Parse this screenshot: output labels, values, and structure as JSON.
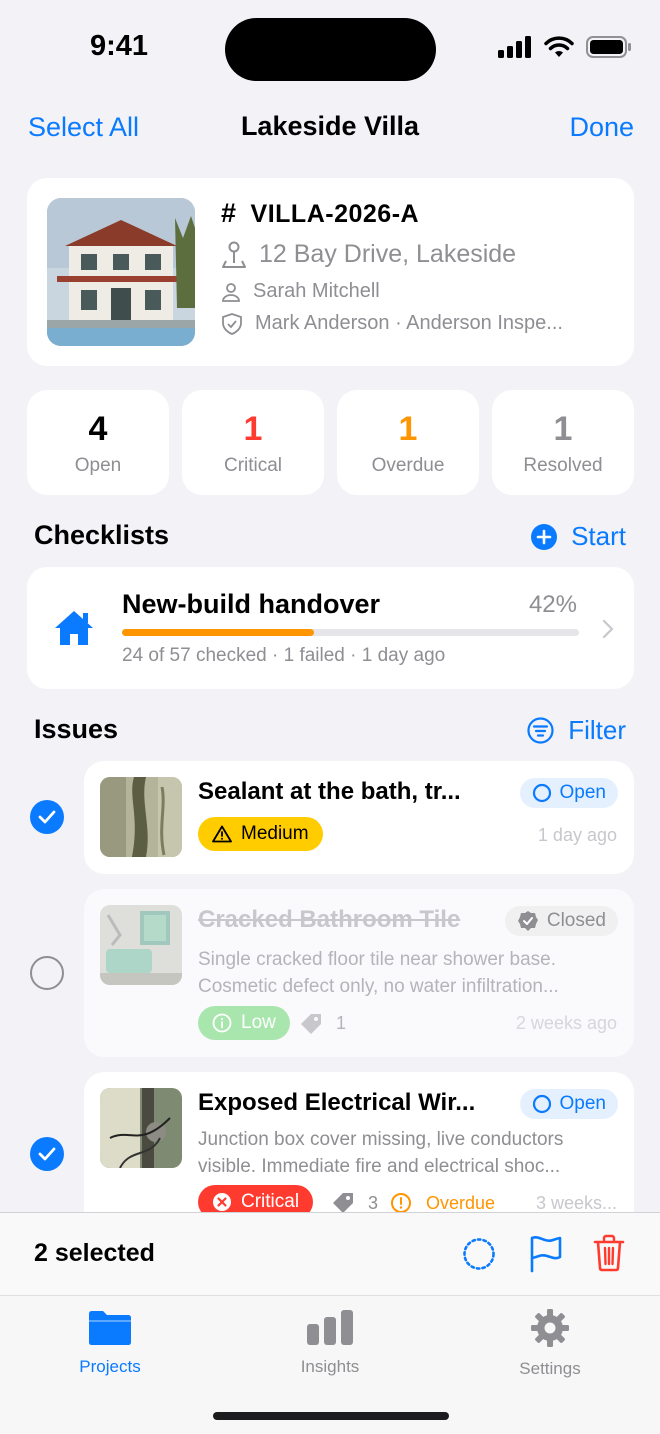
{
  "status_bar": {
    "time": "9:41"
  },
  "nav": {
    "left": "Select All",
    "title": "Lakeside Villa",
    "right": "Done"
  },
  "project": {
    "id": "VILLA-2026-A",
    "id_prefix": "#",
    "address": "12 Bay Drive, Lakeside",
    "owner": "Sarah Mitchell",
    "inspector": "Mark Anderson · Anderson Inspe..."
  },
  "stats": [
    {
      "value": "4",
      "label": "Open",
      "color": "#000000"
    },
    {
      "value": "1",
      "label": "Critical",
      "color": "#ff3b30"
    },
    {
      "value": "1",
      "label": "Overdue",
      "color": "#ff9500"
    },
    {
      "value": "1",
      "label": "Resolved",
      "color": "#8e8e93"
    }
  ],
  "checklists": {
    "title": "Checklists",
    "action": "Start",
    "items": [
      {
        "title": "New-build handover",
        "percent": "42%",
        "progress": 0.42,
        "subtitle": "24 of 57 checked · 1 failed · 1 day ago"
      }
    ]
  },
  "issues": {
    "title": "Issues",
    "action": "Filter",
    "items": [
      {
        "title": "Sealant at the bath, tr...",
        "status": "Open",
        "severity": "Medium",
        "time": "1 day ago",
        "selected": true
      },
      {
        "title": "Cracked Bathroom Tile",
        "status": "Closed",
        "description": "Single cracked floor tile near shower base. Cosmetic defect only, no water infiltration...",
        "severity": "Low",
        "tag_count": "1",
        "time": "2 weeks ago",
        "selected": false
      },
      {
        "title": "Exposed Electrical Wir...",
        "status": "Open",
        "description": "Junction box cover missing, live conductors visible. Immediate fire and electrical shoc...",
        "severity": "Critical",
        "tag_count": "3",
        "flag": "Overdue",
        "time": "3 weeks...",
        "selected": true
      }
    ]
  },
  "selection_bar": {
    "count": "2 selected"
  },
  "tabs": [
    {
      "label": "Projects",
      "icon": "folder-icon",
      "active": true
    },
    {
      "label": "Insights",
      "icon": "chart-bar-icon",
      "active": false
    },
    {
      "label": "Settings",
      "icon": "gear-icon",
      "active": false
    }
  ],
  "colors": {
    "accent": "#0a7aff",
    "critical": "#ff3b30",
    "overdue": "#ff9500",
    "medium": "#ffcc00",
    "low": "#4cd964"
  }
}
